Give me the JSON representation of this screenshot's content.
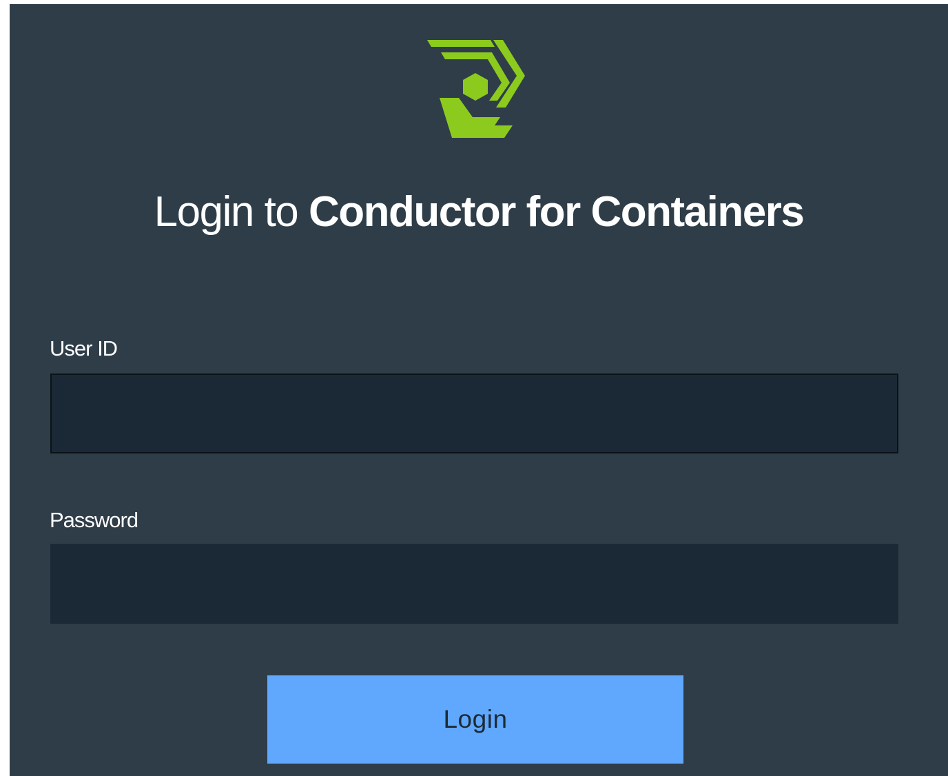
{
  "brand": {
    "logo_icon": "conductor-hexagon-logo",
    "accent_color": "#8ccb1e"
  },
  "login": {
    "title_prefix": "Login to",
    "title_product": "Conductor for Containers",
    "user_id_label": "User ID",
    "user_id_value": "",
    "password_label": "Password",
    "password_value": "",
    "submit_label": "Login"
  },
  "colors": {
    "panel_bg": "#2f3d48",
    "field_bg": "#1a2935",
    "button_bg": "#5fa8fd"
  }
}
